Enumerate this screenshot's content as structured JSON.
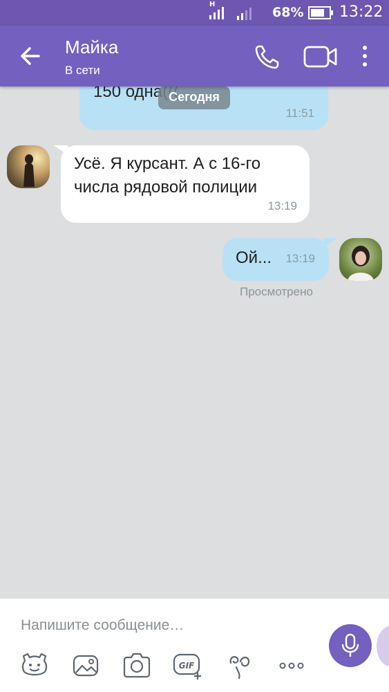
{
  "status_bar": {
    "network_type": "H",
    "battery_percent": "68%",
    "time": "13:22"
  },
  "header": {
    "contact_name": "Майка",
    "contact_status": "В сети",
    "icons": [
      "back-arrow-icon",
      "phone-icon",
      "video-camera-icon",
      "more-vertical-icon"
    ]
  },
  "chat": {
    "date_separator": "Сегодня",
    "previous_message": {
      "text": "150 одна(((",
      "time": "11:51"
    },
    "messages": [
      {
        "direction": "incoming",
        "text": "Усё. Я курсант. А с 16-го числа рядовой полиции",
        "time": "13:19"
      },
      {
        "direction": "outgoing",
        "text": "Ой...",
        "time": "13:19",
        "status": "Просмотрено"
      }
    ]
  },
  "composer": {
    "placeholder": "Напишите сообщение…",
    "toolbar_icons": [
      "sticker-icon",
      "gallery-icon",
      "camera-icon",
      "gif-icon",
      "doodle-icon",
      "more-horizontal-icon"
    ],
    "mic_icon": "microphone-icon"
  },
  "colors": {
    "header": "#7360bf",
    "status_bar": "#6e57b0",
    "chat_background": "#dcdedf",
    "incoming_bubble": "#ffffff",
    "outgoing_bubble": "#b9e1f6",
    "timestamp": "#8a9aa3"
  }
}
